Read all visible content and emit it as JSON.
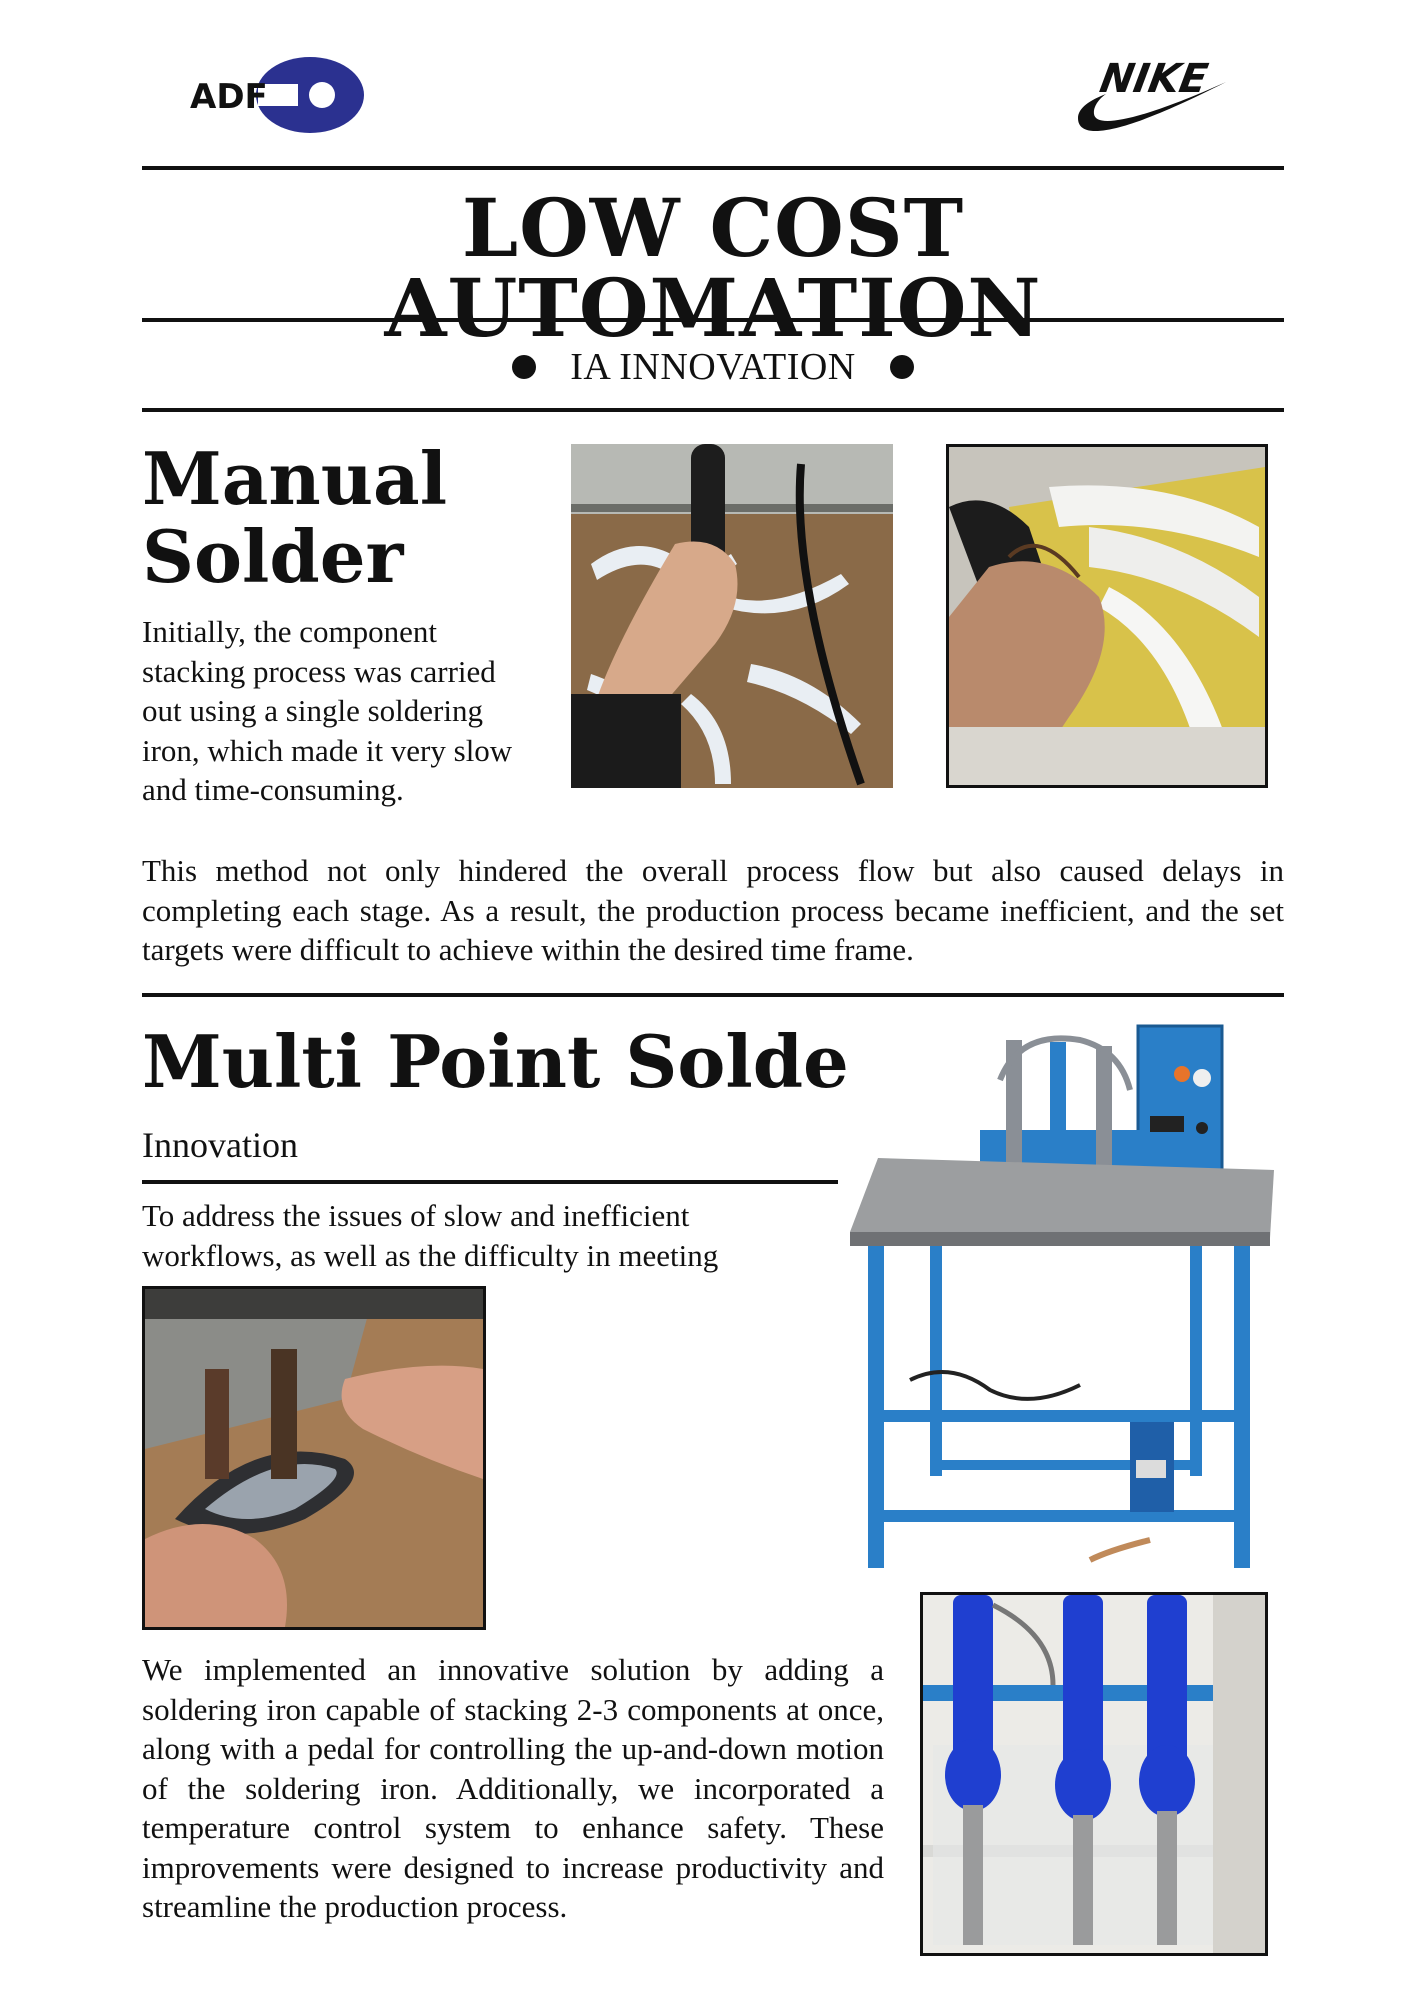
{
  "header": {
    "logo_left": "ADF",
    "logo_right": "NIKE",
    "title": "LOW COST AUTOMATION",
    "subtitle": "IA INNOVATION"
  },
  "manual": {
    "heading": "Manual Solder",
    "intro": "Initially, the component stacking process was carried out using a single soldering iron, which made it very slow and time-consuming.",
    "detail": "This method not only hindered the overall process flow but also caused delays in completing each stage. As a result, the production process became inefficient, and the set targets were difficult to achieve within the desired time frame."
  },
  "multi": {
    "heading": "Multi Point Solder",
    "subheading": "Innovation",
    "intro": "To address the issues of slow and inefficient workflows, as well as the difficulty in meeting targets,",
    "solution": "We implemented an innovative solution by adding a soldering iron capable of stacking 2-3 components at once, along with a pedal for controlling the up-and-down motion of the soldering iron. Additionally, we incorporated a temperature control system to enhance safety. These improvements were designed to increase productivity and streamline the production process."
  },
  "colors": {
    "adf_blue": "#2b3190",
    "ink": "#111111",
    "machine_blue": "#2a7fc8",
    "iron_blue": "#1f3fd0"
  },
  "icons": [
    "adf-logo-icon",
    "nike-logo-icon"
  ]
}
